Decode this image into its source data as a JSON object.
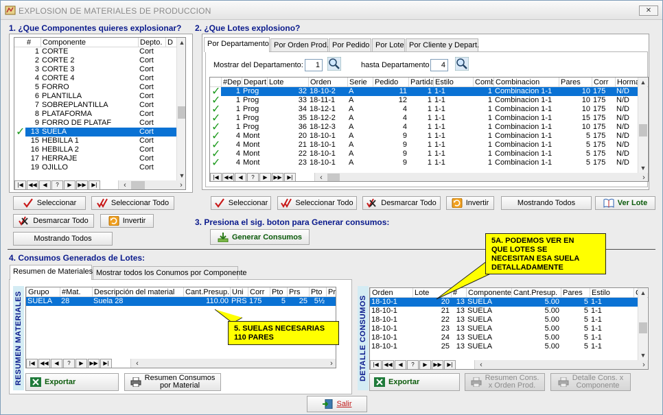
{
  "window": {
    "title": "EXPLOSION DE MATERIALES DE PRODUCCION",
    "close": "✕"
  },
  "section1": {
    "title": "1. ¿Que Componentes quieres explosionar?"
  },
  "section2": {
    "title": "2. ¿Que Lotes explosiono?"
  },
  "section3": {
    "title": "3. Presiona el sig. boton para Generar consumos:"
  },
  "section4": {
    "title": "4. Consumos Generados de Lotes:"
  },
  "components": {
    "headers": [
      "#",
      "Componente",
      "Depto.",
      "D"
    ],
    "rows": [
      {
        "num": "1",
        "name": "CORTE",
        "dept": "Cort",
        "check": false,
        "selected": false
      },
      {
        "num": "2",
        "name": "CORTE 2",
        "dept": "Cort",
        "check": false,
        "selected": false
      },
      {
        "num": "3",
        "name": "CORTE 3",
        "dept": "Cort",
        "check": false,
        "selected": false
      },
      {
        "num": "4",
        "name": "CORTE 4",
        "dept": "Cort",
        "check": false,
        "selected": false
      },
      {
        "num": "5",
        "name": "FORRO",
        "dept": "Cort",
        "check": false,
        "selected": false
      },
      {
        "num": "6",
        "name": "PLANTILLA",
        "dept": "Cort",
        "check": false,
        "selected": false
      },
      {
        "num": "7",
        "name": "SOBREPLANTILLA",
        "dept": "Cort",
        "check": false,
        "selected": false
      },
      {
        "num": "8",
        "name": "PLATAFORMA",
        "dept": "Cort",
        "check": false,
        "selected": false
      },
      {
        "num": "9",
        "name": "FORRO DE PLATAF",
        "dept": "Cort",
        "check": false,
        "selected": false
      },
      {
        "num": "13",
        "name": "SUELA",
        "dept": "Cort",
        "check": true,
        "selected": true
      },
      {
        "num": "15",
        "name": "HEBILLA 1",
        "dept": "Cort",
        "check": false,
        "selected": false
      },
      {
        "num": "16",
        "name": "HEBILLA 2",
        "dept": "Cort",
        "check": false,
        "selected": false
      },
      {
        "num": "17",
        "name": "HERRAJE",
        "dept": "Cort",
        "check": false,
        "selected": false
      },
      {
        "num": "19",
        "name": "OJILLO",
        "dept": "Cort",
        "check": false,
        "selected": false
      }
    ]
  },
  "nav": [
    "|◀",
    "◀◀",
    "◀",
    "?",
    "▶",
    "▶▶",
    "▶|"
  ],
  "buttons1": {
    "seleccionar": "Seleccionar",
    "seleccionar_todo": "Seleccionar Todo",
    "desmarcar_todo": "Desmarcar Todo",
    "invertir": "Invertir",
    "mostrando_todos": "Mostrando Todos"
  },
  "buttons2": {
    "seleccionar": "Seleccionar",
    "seleccionar_todo": "Seleccionar Todo",
    "desmarcar_todo": "Desmarcar Todo",
    "invertir": "Invertir",
    "mostrando_todos": "Mostrando Todos",
    "ver_lote": "Ver Lote"
  },
  "lots_tabs": [
    "Por Departamento",
    "Por Orden Prod.",
    "Por Pedido",
    "Por Lote",
    "Por Cliente y Depart."
  ],
  "filter": {
    "from_label": "Mostrar del Departamento:",
    "from_value": "1",
    "to_label": "hasta Departamento",
    "to_value": "4"
  },
  "lots": {
    "headers": [
      "#Dep",
      "Depart",
      "Lote",
      "Orden",
      "Serie",
      "Pedido",
      "Partida",
      "Estilo",
      "Comb",
      "Combinacion",
      "Pares",
      "Corr",
      "Horma"
    ],
    "rows": [
      {
        "dep": "1",
        "depart": "Prog",
        "lote": "32",
        "orden": "18-10-2",
        "serie": "A",
        "pedido": "11",
        "partida": "1",
        "estilo": "1-1",
        "comb": "1",
        "combinacion": "Combinacion 1-1",
        "pares": "10",
        "corr": "175",
        "horma": "N/D",
        "selected": true
      },
      {
        "dep": "1",
        "depart": "Prog",
        "lote": "33",
        "orden": "18-11-1",
        "serie": "A",
        "pedido": "12",
        "partida": "1",
        "estilo": "1-1",
        "comb": "1",
        "combinacion": "Combinacion 1-1",
        "pares": "10",
        "corr": "175",
        "horma": "N/D",
        "selected": false
      },
      {
        "dep": "1",
        "depart": "Prog",
        "lote": "34",
        "orden": "18-12-1",
        "serie": "A",
        "pedido": "4",
        "partida": "1",
        "estilo": "1-1",
        "comb": "1",
        "combinacion": "Combinacion 1-1",
        "pares": "10",
        "corr": "175",
        "horma": "N/D",
        "selected": false
      },
      {
        "dep": "1",
        "depart": "Prog",
        "lote": "35",
        "orden": "18-12-2",
        "serie": "A",
        "pedido": "4",
        "partida": "1",
        "estilo": "1-1",
        "comb": "1",
        "combinacion": "Combinacion 1-1",
        "pares": "15",
        "corr": "175",
        "horma": "N/D",
        "selected": false
      },
      {
        "dep": "1",
        "depart": "Prog",
        "lote": "36",
        "orden": "18-12-3",
        "serie": "A",
        "pedido": "4",
        "partida": "1",
        "estilo": "1-1",
        "comb": "1",
        "combinacion": "Combinacion 1-1",
        "pares": "10",
        "corr": "175",
        "horma": "N/D",
        "selected": false
      },
      {
        "dep": "4",
        "depart": "Mont",
        "lote": "20",
        "orden": "18-10-1",
        "serie": "A",
        "pedido": "9",
        "partida": "1",
        "estilo": "1-1",
        "comb": "1",
        "combinacion": "Combinacion 1-1",
        "pares": "5",
        "corr": "175",
        "horma": "N/D",
        "selected": false
      },
      {
        "dep": "4",
        "depart": "Mont",
        "lote": "21",
        "orden": "18-10-1",
        "serie": "A",
        "pedido": "9",
        "partida": "1",
        "estilo": "1-1",
        "comb": "1",
        "combinacion": "Combinacion 1-1",
        "pares": "5",
        "corr": "175",
        "horma": "N/D",
        "selected": false
      },
      {
        "dep": "4",
        "depart": "Mont",
        "lote": "22",
        "orden": "18-10-1",
        "serie": "A",
        "pedido": "9",
        "partida": "1",
        "estilo": "1-1",
        "comb": "1",
        "combinacion": "Combinacion 1-1",
        "pares": "5",
        "corr": "175",
        "horma": "N/D",
        "selected": false
      },
      {
        "dep": "4",
        "depart": "Mont",
        "lote": "23",
        "orden": "18-10-1",
        "serie": "A",
        "pedido": "9",
        "partida": "1",
        "estilo": "1-1",
        "comb": "1",
        "combinacion": "Combinacion 1-1",
        "pares": "5",
        "corr": "175",
        "horma": "N/D",
        "selected": false
      }
    ]
  },
  "generar": "Generar Consumos",
  "summary_tabs": [
    "Resumen de Materiales",
    "Mostrar todos los Conumos por Componente"
  ],
  "summary": {
    "side_label": "RESUMEN MATERIALES",
    "headers": [
      "Grupo",
      "#Mat.",
      "Descripción del material",
      "Cant.Presup.",
      "Uni",
      "Corr",
      "Pto",
      "Prs",
      "Pto",
      "Pr"
    ],
    "rows": [
      {
        "grupo": "SUELA",
        "mat": "28",
        "desc": "Suela 28",
        "cant": "110.00",
        "uni": "PRS",
        "corr": "175",
        "pto": "5",
        "prs": "25",
        "pto2": "5½",
        "pr": ""
      }
    ],
    "exportar": "Exportar",
    "resumen_line1": "Resumen Consumos",
    "resumen_line2": "por Material"
  },
  "detail": {
    "side_label": "DETALLE CONSUMOS",
    "headers": [
      "Orden",
      "Lote",
      "#",
      "Componente",
      "Cant.Presup.",
      "Pares",
      "Estilo",
      "C"
    ],
    "rows": [
      {
        "orden": "18-10-1",
        "lote": "20",
        "num": "13",
        "comp": "SUELA",
        "cant": "5.00",
        "pares": "5",
        "estilo": "1-1",
        "selected": true
      },
      {
        "orden": "18-10-1",
        "lote": "21",
        "num": "13",
        "comp": "SUELA",
        "cant": "5.00",
        "pares": "5",
        "estilo": "1-1",
        "selected": false
      },
      {
        "orden": "18-10-1",
        "lote": "22",
        "num": "13",
        "comp": "SUELA",
        "cant": "5.00",
        "pares": "5",
        "estilo": "1-1",
        "selected": false
      },
      {
        "orden": "18-10-1",
        "lote": "23",
        "num": "13",
        "comp": "SUELA",
        "cant": "5.00",
        "pares": "5",
        "estilo": "1-1",
        "selected": false
      },
      {
        "orden": "18-10-1",
        "lote": "24",
        "num": "13",
        "comp": "SUELA",
        "cant": "5.00",
        "pares": "5",
        "estilo": "1-1",
        "selected": false
      },
      {
        "orden": "18-10-1",
        "lote": "25",
        "num": "13",
        "comp": "SUELA",
        "cant": "5.00",
        "pares": "5",
        "estilo": "1-1",
        "selected": false
      }
    ],
    "exportar": "Exportar",
    "btn_orden_line1": "Resumen Cons.",
    "btn_orden_line2": "x Orden Prod.",
    "btn_comp_line1": "Detalle Cons. x",
    "btn_comp_line2": "Componente"
  },
  "callouts": {
    "c5_line1": "5. SUELAS NECESARIAS",
    "c5_line2": "110 PARES",
    "c5a_line1": "5A. PODEMOS VER EN",
    "c5a_line2": "QUE LOTES SE",
    "c5a_line3": "NECESITAN ESA SUELA",
    "c5a_line4": "DETALLADAMENTE"
  },
  "salir": "Salir",
  "colors": {
    "selection": "#0a72d4",
    "section_text": "#0a1a8c",
    "callout": "#ffff00",
    "check": "#1c9a1c"
  }
}
